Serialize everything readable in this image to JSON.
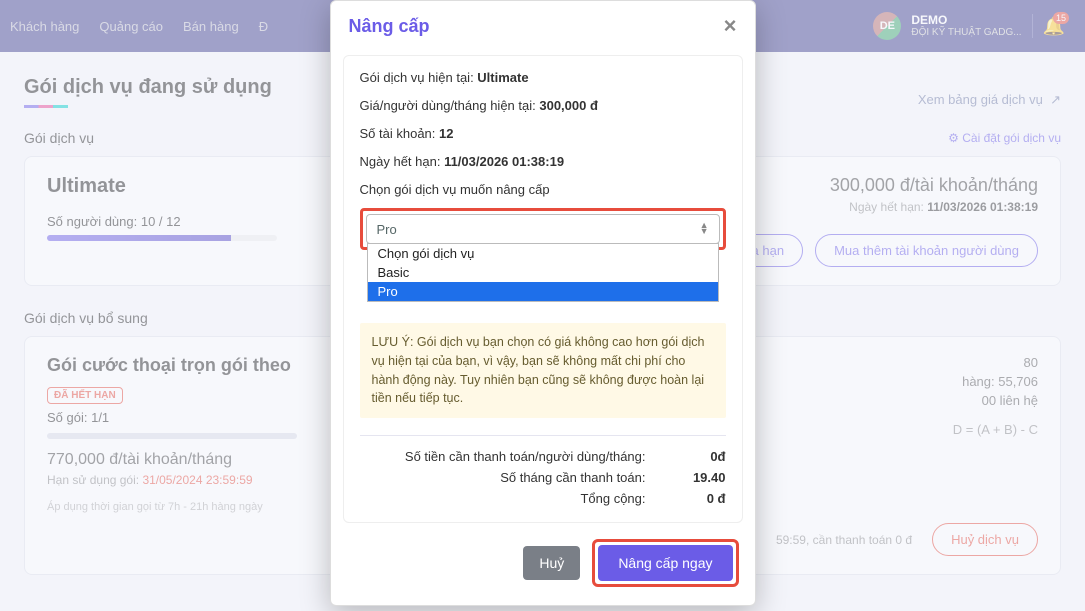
{
  "topnav": {
    "items": [
      "Khách hàng",
      "Quảng cáo",
      "Bán hàng",
      "Đ"
    ],
    "user": {
      "initials": "DE",
      "name": "DEMO",
      "team": "ĐỘI KỸ THUẬT GADG..."
    },
    "notif_count": "15"
  },
  "page": {
    "title": "Gói dịch vụ đang sử dụng",
    "view_price": "Xem bảng giá dịch vụ",
    "section1": "Gói dịch vụ",
    "settings": "Cài đặt gói dịch vụ",
    "section2": "Gói dịch vụ bổ sung"
  },
  "plan_card": {
    "name": "Ultimate",
    "users_line": "Số người dùng: 10 / 12",
    "price": "300,000 đ/tài khoản/tháng",
    "expire_prefix": "Ngày hết hạn: ",
    "expire_value": "11/03/2026 01:38:19",
    "btn_extend": "Gia hạn",
    "btn_buy_more": "Mua thêm tài khoản người dùng"
  },
  "addon_card": {
    "title": "Gói cước thoại trọn gói theo",
    "badge": "ĐÃ HẾT HẠN",
    "count": "Số gói: 1/1",
    "price": "770,000 đ/tài khoản/tháng",
    "expire_prefix": "Hạn sử dụng gói: ",
    "expire_value": "31/05/2024 23:59:59",
    "note": "Áp dụng thời gian gọi từ 7h - 21h hàng ngày",
    "right": {
      "line1_suffix": "80",
      "line2": "hàng: 55,706",
      "line3": "00 liên hệ",
      "formula": "D = (A + B) - C"
    },
    "footer_left": "59:59, cần thanh toán 0 đ",
    "cancel_btn": "Huỷ dịch vụ"
  },
  "modal": {
    "title": "Nâng cấp",
    "line_plan_label": "Gói dịch vụ hiện tại: ",
    "line_plan_value": "Ultimate",
    "line_price_label": "Giá/người dùng/tháng hiện tại: ",
    "line_price_value": "300,000 đ",
    "line_accounts_label": "Số tài khoản: ",
    "line_accounts_value": "12",
    "line_expire_label": "Ngày hết hạn: ",
    "line_expire_value": "11/03/2026 01:38:19",
    "select_label": "Chọn gói dịch vụ muốn nâng cấp",
    "select_value": "Pro",
    "options": [
      "Chọn gói dịch vụ",
      "Basic",
      "Pro"
    ],
    "warning": "LƯU Ý: Gói dịch vụ bạn chọn có giá không cao hơn gói dịch vụ hiện tại của bạn, vì vậy, bạn sẽ không mất chi phí cho hành động này. Tuy nhiên bạn cũng sẽ không được hoàn lại tiền nếu tiếp tục.",
    "totals": {
      "perUserLabel": "Số tiền cần thanh toán/người dùng/tháng:",
      "perUserValue": "0đ",
      "monthsLabel": "Số tháng cần thanh toán:",
      "monthsValue": "19.40",
      "sumLabel": "Tổng cộng:",
      "sumValue": "0 đ"
    },
    "btn_cancel": "Huỷ",
    "btn_submit": "Nâng cấp ngay"
  }
}
